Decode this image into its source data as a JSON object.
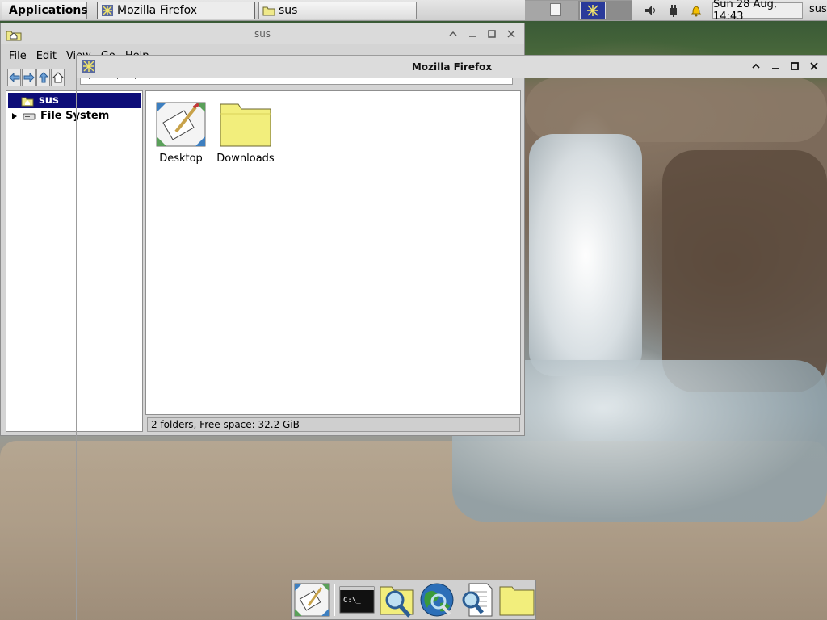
{
  "top_panel": {
    "applications_label": "Applications",
    "tasks": [
      {
        "label": "Mozilla Firefox",
        "icon": "firefox-icon",
        "active": true
      },
      {
        "label": "sus",
        "icon": "folder-icon",
        "active": false
      }
    ],
    "clock": "Sun 28 Aug, 14:43",
    "user": "sus"
  },
  "file_manager": {
    "title": "sus",
    "menu": [
      "File",
      "Edit",
      "View",
      "Go",
      "Help"
    ],
    "location": "/home/sus/",
    "tree": [
      {
        "label": "sus",
        "icon": "home-folder-icon",
        "selected": true
      },
      {
        "label": "File System",
        "icon": "drive-icon",
        "selected": false
      }
    ],
    "items": [
      {
        "label": "Desktop",
        "icon": "desktop-folder-icon"
      },
      {
        "label": "Downloads",
        "icon": "folder-icon"
      }
    ],
    "status": "2 folders, Free space: 32.2 GiB"
  },
  "firefox": {
    "title": "Mozilla Firefox"
  },
  "dock": {
    "items": [
      "desktop-icon",
      "terminal-icon",
      "file-search-icon",
      "web-browser-icon",
      "document-search-icon",
      "folder-icon"
    ]
  },
  "colors": {
    "selection": "#0d0d78",
    "panel": "#dcdcdc",
    "folder_yellow": "#f2ee7c"
  }
}
